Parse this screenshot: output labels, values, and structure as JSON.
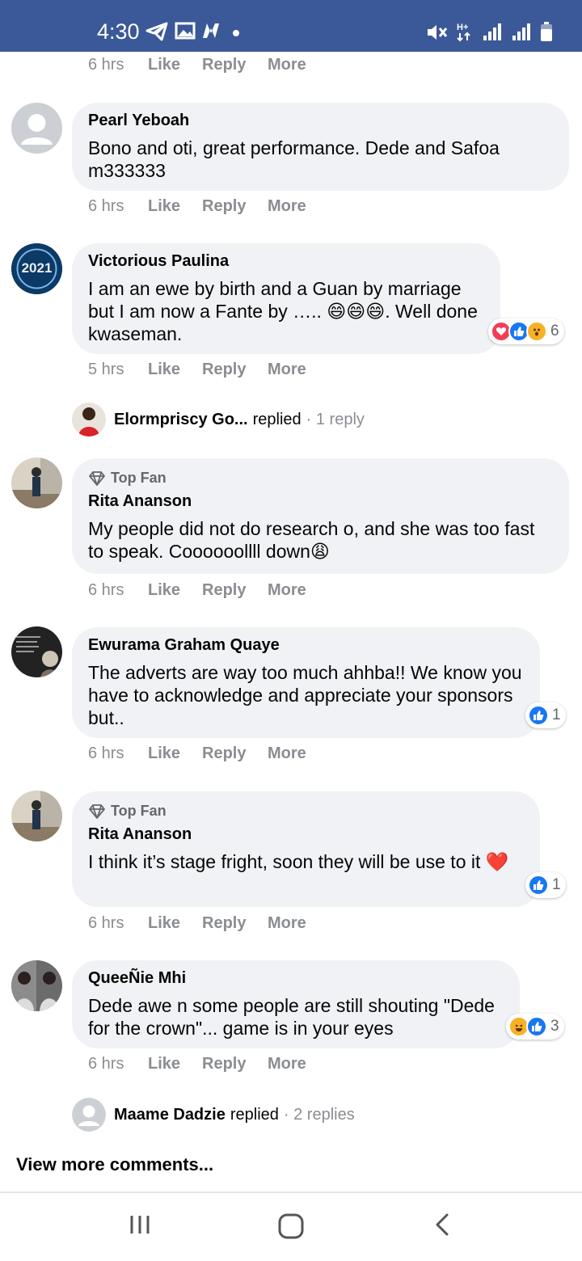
{
  "status_bar": {
    "time": "4:30",
    "left_icons": [
      "telegram-icon",
      "image-icon",
      "app-n-icon",
      "dot-icon"
    ],
    "right_icons": [
      "mute-icon",
      "network-h-plus-icon",
      "signal-icon",
      "signal-icon",
      "battery-icon"
    ],
    "network_label": "H+",
    "bg_color": "#3b5998"
  },
  "labels": {
    "like": "Like",
    "reply": "Reply",
    "more": "More",
    "top_fan": "Top Fan",
    "replied": "replied",
    "view_more": "View more comments..."
  },
  "top_meta": {
    "time": "6 hrs"
  },
  "comments": [
    {
      "author": "Pearl Yeboah",
      "text": "Bono and oti, great performance. Dede and Safoa m333333",
      "time": "6 hrs"
    },
    {
      "author": "Victorious Paulina",
      "text": "I am an ewe by birth and a Guan by marriage but I am now a Fante by ….. 😄😄😄. Well done kwaseman.",
      "time": "5 hrs",
      "reactions": {
        "types": [
          "love",
          "like",
          "wow"
        ],
        "count": "6"
      }
    },
    {
      "author": "Rita Ananson",
      "badge": "Top Fan",
      "text": "My people did not do research o, and she was too fast to speak. Coooooollll down😩",
      "time": "6 hrs"
    },
    {
      "author": "Ewurama Graham Quaye",
      "text": "The adverts are way too much ahhba!! We know you have to acknowledge and appreciate your sponsors but..",
      "time": "6 hrs",
      "reactions": {
        "types": [
          "like"
        ],
        "count": "1"
      }
    },
    {
      "author": "Rita Ananson",
      "badge": "Top Fan",
      "text": "I think it’s stage fright, soon they will be use to it ❤️",
      "time": "6 hrs",
      "reactions": {
        "types": [
          "like"
        ],
        "count": "1"
      }
    },
    {
      "author": "QueeÑie Mhi",
      "text": "Dede awe n some people are still shouting \"Dede for the crown\"... game is in your eyes",
      "time": "6 hrs",
      "reactions": {
        "types": [
          "haha",
          "like"
        ],
        "count": "3"
      }
    }
  ],
  "replies": [
    {
      "name": "Elormpriscy Go...",
      "count": "1 reply"
    },
    {
      "name": "Maame Dadzie",
      "count": "2 replies"
    }
  ],
  "nav": {
    "icons": [
      "recent-apps-icon",
      "home-icon",
      "back-icon"
    ]
  }
}
